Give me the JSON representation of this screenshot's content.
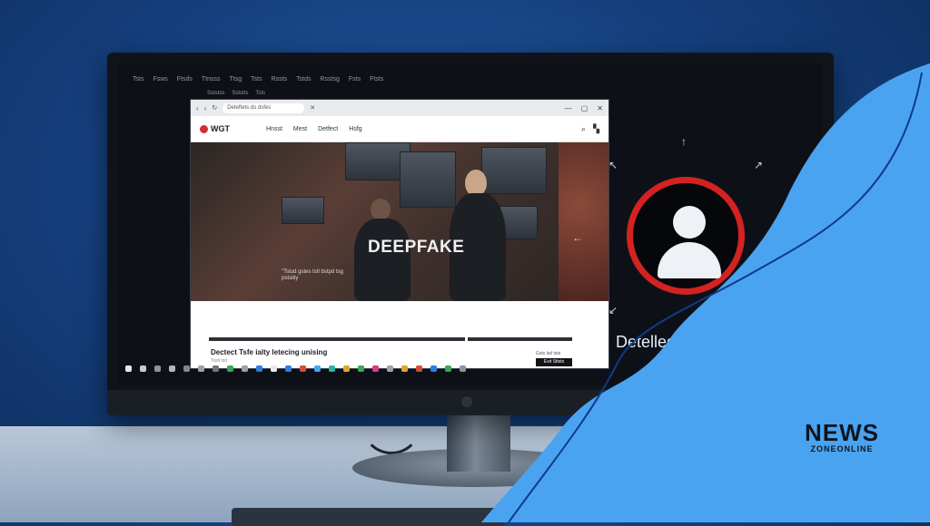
{
  "desktop": {
    "menu_items": [
      "Tsts",
      "Fsws",
      "Ftsds",
      "Ttnsss",
      "Ttsg",
      "Tsts",
      "Rssts",
      "Tstds",
      "Rsstsg",
      "Fsts",
      "Ftsts"
    ],
    "sub_items": [
      "Sststss",
      "Sststts",
      "Tsts"
    ]
  },
  "browser": {
    "url": "Deteftets ds dsfes",
    "window_controls": [
      "—",
      "▢",
      "✕"
    ]
  },
  "site": {
    "logo": "WGT",
    "nav": [
      "Hnsst",
      "Mest",
      "Detfect",
      "Hsfg"
    ],
    "hero_title": "DEEPFAKE",
    "hero_caption": "\"Tstud gstes tstl bstpd tsg pstsitiy",
    "bottom_title": "Dectect Tsfe ialty letecing unising",
    "bottom_sub": "Tsstl tsd",
    "bottom_right": "Gsts lsd tsts",
    "exit_label": "Exit Sttsts"
  },
  "detection": {
    "label": "Detelled ligait",
    "accent": "#d32222"
  },
  "branding": {
    "news": "NEWS",
    "sub": "ZONEONLINE",
    "color": "#4aa3f0"
  }
}
